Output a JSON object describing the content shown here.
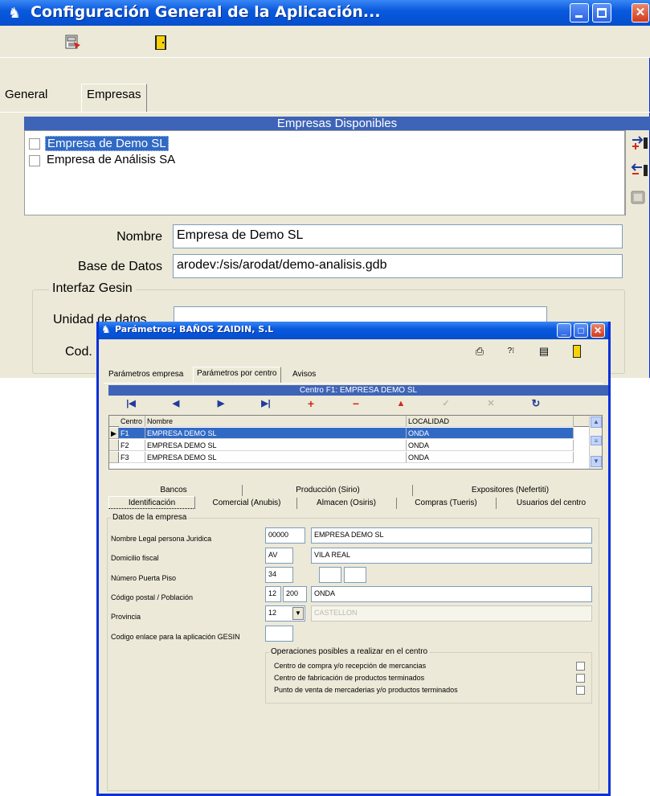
{
  "main_window": {
    "title": "Configuración General de la Aplicación...",
    "tabs": [
      "General",
      "Empresas"
    ],
    "active_tab": "Empresas",
    "group_header": "Empresas Disponibles",
    "companies": [
      {
        "name": "Empresa de Demo SL",
        "checked": false,
        "selected": true
      },
      {
        "name": "Empresa de Análisis SA",
        "checked": false,
        "selected": false
      }
    ],
    "fields": {
      "nombre_label": "Nombre",
      "nombre_value": "Empresa de Demo SL",
      "base_datos_label": "Base de Datos",
      "base_datos_value": "arodev:/sis/arodat/demo-analisis.gdb"
    },
    "gesin": {
      "legend": "Interfaz Gesin",
      "unidad_label": "Unidad de datos",
      "unidad_value": "",
      "cod_label": "Cod. E"
    }
  },
  "dialog": {
    "title": "Parámetros;    BAÑOS ZAIDIN, S.L",
    "tabs": [
      "Parámetros empresa",
      "Parámetros por centro",
      "Avisos"
    ],
    "active_tab": "Parámetros por centro",
    "centro_header": "Centro F1: EMPRESA DEMO SL",
    "grid": {
      "columns": [
        "Centro",
        "Nombre",
        "LOCALIDAD"
      ],
      "rows": [
        {
          "centro": "F1",
          "nombre": "EMPRESA DEMO SL",
          "localidad": "ONDA",
          "selected": true
        },
        {
          "centro": "F2",
          "nombre": "EMPRESA DEMO SL",
          "localidad": "ONDA",
          "selected": false
        },
        {
          "centro": "F3",
          "nombre": "EMPRESA DEMO SL",
          "localidad": "ONDA",
          "selected": false
        }
      ]
    },
    "subtabs_row1": [
      "Bancos",
      "Producción (Sirio)",
      "Expositores (Nefertiti)"
    ],
    "subtabs_row2": [
      "Identificación",
      "Comercial (Anubis)",
      "Almacen (Osiris)",
      "Compras (Tueris)",
      "Usuarios del centro"
    ],
    "active_subtab": "Identificación",
    "datos": {
      "legend": "Datos de la empresa",
      "nombre_legal_label": "Nombre Legal persona Juridica",
      "nombre_legal_code": "00000",
      "nombre_legal_value": "EMPRESA DEMO SL",
      "domicilio_label": "Domicilio fiscal",
      "domicilio_tipo": "AV",
      "domicilio_value": "VILA REAL",
      "numero_label": "Número Puerta  Piso",
      "numero_value": "34",
      "puerta_value": "",
      "piso_value": "",
      "cp_label": "Código postal / Población",
      "cp_prov": "12",
      "cp_num": "200",
      "poblacion_value": "ONDA",
      "provincia_label": "Provincia",
      "provincia_code": "12",
      "provincia_name": "CASTELLON",
      "gesin_label": "Codigo enlace para la aplicación GESIN",
      "gesin_value": ""
    },
    "operaciones": {
      "legend": "Operaciones posibles a realizar en el centro",
      "items": [
        "Centro de compra y/o recepción de mercancias",
        "Centro de fabricación de productos terminados",
        "Punto de venta de mercaderias y/o productos terminados"
      ]
    }
  },
  "colors": {
    "titlebar": "#0553d6",
    "window_bg": "#ece9d8",
    "header_blue": "#3e64b7",
    "selection": "#316ac5"
  }
}
